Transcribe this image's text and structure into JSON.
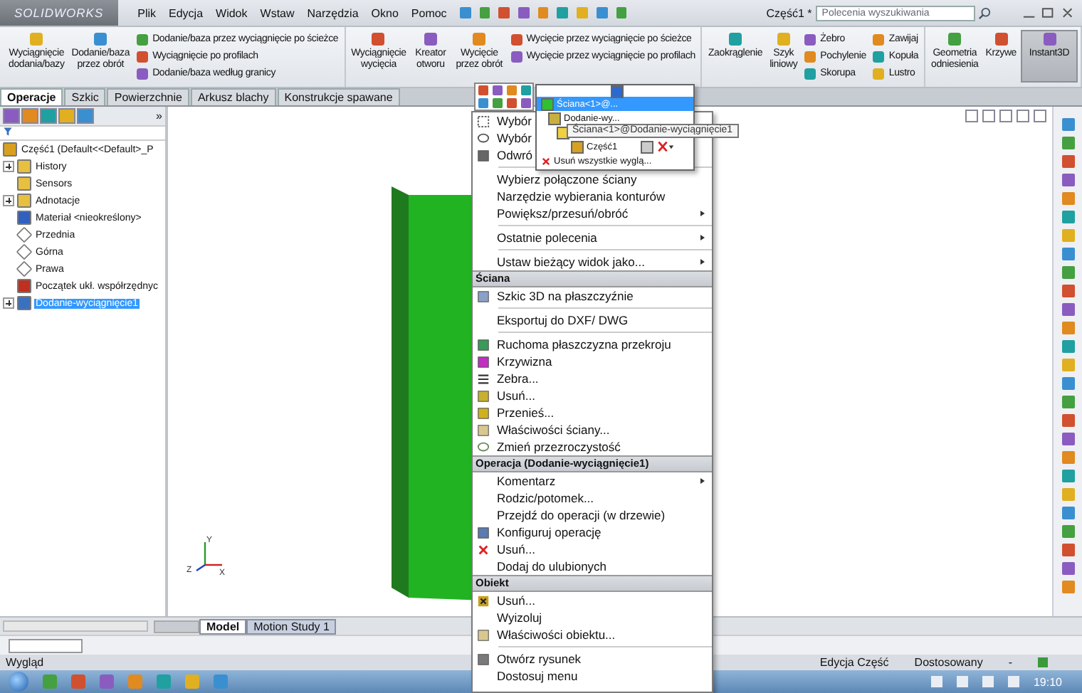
{
  "titlebar": {
    "logo": "SOLIDWORKS",
    "menu": [
      "Plik",
      "Edycja",
      "Widok",
      "Wstaw",
      "Narzędzia",
      "Okno",
      "Pomoc"
    ],
    "title": "Część1 *",
    "search": {
      "placeholder": "Polecenia wyszukiwania"
    }
  },
  "ribbon": {
    "groups": [
      {
        "large": [
          {
            "label": "Wyciągnięcie dodania/bazy",
            "selected": false
          },
          {
            "label": "Dodanie/baza przez obrót",
            "selected": false
          }
        ],
        "columns": [
          [
            "Dodanie/baza przez wyciągnięcie po ścieżce",
            "Wyciągnięcie po profilach",
            "Dodanie/baza według granicy"
          ]
        ]
      },
      {
        "large": [
          {
            "label": "Wyciągnięcie wycięcia",
            "selected": false
          },
          {
            "label": "Kreator otworu",
            "selected": false
          },
          {
            "label": "Wycięcie przez obrót",
            "selected": false
          }
        ],
        "columns": [
          [
            "Wycięcie przez wyciągnięcie po ścieżce",
            "Wycięcie przez wyciągnięcie po profilach"
          ]
        ]
      },
      {
        "large": [
          {
            "label": "Zaokrąglenie",
            "selected": false
          },
          {
            "label": "Szyk liniowy",
            "selected": false
          }
        ],
        "columns": [
          [
            "Żebro",
            "Pochylenie",
            "Skorupa"
          ],
          [
            "Zawijaj",
            "Kopuła",
            "Lustro"
          ]
        ]
      },
      {
        "large": [
          {
            "label": "Geometria odniesienia",
            "selected": false
          },
          {
            "label": "Krzywe",
            "selected": false
          },
          {
            "label": "Instant3D",
            "selected": true
          }
        ]
      }
    ]
  },
  "tabs": [
    {
      "label": "Operacje",
      "selected": true
    },
    {
      "label": "Szkic",
      "selected": false
    },
    {
      "label": "Powierzchnie",
      "selected": false
    },
    {
      "label": "Arkusz blachy",
      "selected": false
    },
    {
      "label": "Konstrukcje spawane",
      "selected": false
    }
  ],
  "panel": {
    "more": "»",
    "tree": {
      "label": "Część1  (Default<<Default>_P",
      "kind": "part",
      "children": [
        {
          "label": "History",
          "kind": "folder",
          "expanded": false,
          "selected": false
        },
        {
          "label": "Sensors",
          "kind": "folder",
          "selected": false
        },
        {
          "label": "Adnotacje",
          "kind": "folder",
          "expanded": false,
          "selected": false
        },
        {
          "label": "Materiał <nieokreślony>",
          "kind": "material",
          "selected": false
        },
        {
          "label": "Przednia",
          "kind": "plane",
          "selected": false
        },
        {
          "label": "Górna",
          "kind": "plane",
          "selected": false
        },
        {
          "label": "Prawa",
          "kind": "plane",
          "selected": false
        },
        {
          "label": "Początek ukł. współrzędnyc",
          "kind": "origin",
          "selected": false
        },
        {
          "label": "Dodanie-wyciągnięcie1",
          "kind": "feature",
          "expanded": false,
          "selected": true
        }
      ]
    }
  },
  "triad": [
    "Y",
    "Z",
    "X"
  ],
  "bottom_tabs": [
    {
      "label": "Model",
      "selected": true
    },
    {
      "label": "Motion Study 1",
      "selected": false
    }
  ],
  "status_bar": {
    "left": "Wygląd",
    "right": [
      "Edycja Część",
      "Dostosowany",
      "-"
    ]
  },
  "taskbar": {
    "clock": "19:10"
  },
  "context_menu": {
    "sections": [
      {
        "blocks": [
          [
            {
              "label": "Wybór",
              "kind": "select",
              "submenu": false
            },
            {
              "label": "Wybór",
              "kind": "lasso",
              "submenu": false
            },
            {
              "label": "Odwró",
              "kind": "invert",
              "submenu": false
            }
          ],
          [
            {
              "label": "Wybierz połączone ściany",
              "kind": "plain",
              "submenu": false
            },
            {
              "label": "Narzędzie wybierania konturów",
              "kind": "plain",
              "submenu": false
            },
            {
              "label": "Powiększ/przesuń/obróć",
              "kind": "plain",
              "submenu": true
            }
          ],
          [
            {
              "label": "Ostatnie polecenia",
              "kind": "plain",
              "submenu": true
            }
          ],
          [
            {
              "label": "Ustaw bieżący widok jako...",
              "kind": "plain",
              "submenu": true
            }
          ]
        ]
      },
      {
        "header": "Ściana",
        "blocks": [
          [
            {
              "label": "Szkic 3D na płaszczyźnie",
              "kind": "sketch",
              "submenu": false
            }
          ],
          [
            {
              "label": "Eksportuj do DXF/ DWG",
              "kind": "plain",
              "submenu": false
            }
          ],
          [
            {
              "label": "Ruchoma płaszczyzna przekroju",
              "kind": "section",
              "submenu": false
            },
            {
              "label": "Krzywizna",
              "kind": "curvature",
              "submenu": false
            },
            {
              "label": "Zebra...",
              "kind": "zebra",
              "submenu": false
            },
            {
              "label": "Usuń...",
              "kind": "face",
              "submenu": false
            },
            {
              "label": "Przenieś...",
              "kind": "move",
              "submenu": false
            },
            {
              "label": "Właściwości ściany...",
              "kind": "props",
              "submenu": false
            },
            {
              "label": "Zmień przezroczystość",
              "kind": "transparency",
              "submenu": false
            }
          ]
        ]
      },
      {
        "header": "Operacja (Dodanie-wyciągnięcie1)",
        "blocks": [
          [
            {
              "label": "Komentarz",
              "kind": "plain",
              "submenu": true
            },
            {
              "label": "Rodzic/potomek...",
              "kind": "plain",
              "submenu": false
            },
            {
              "label": "Przejdź do operacji (w drzewie)",
              "kind": "plain",
              "submenu": false
            },
            {
              "label": "Konfiguruj operację",
              "kind": "config",
              "submenu": false
            },
            {
              "label": "Usuń...",
              "kind": "delete",
              "submenu": false
            },
            {
              "label": "Dodaj do ulubionych",
              "kind": "plain",
              "submenu": false
            }
          ]
        ]
      },
      {
        "header": "Obiekt",
        "blocks": [
          [
            {
              "label": "Usuń...",
              "kind": "delete-box",
              "submenu": false
            },
            {
              "label": "Wyizoluj",
              "kind": "plain",
              "submenu": false
            },
            {
              "label": "Właściwości obiektu...",
              "kind": "props",
              "submenu": false
            }
          ],
          [
            {
              "label": "Otwórz rysunek",
              "kind": "drawing",
              "submenu": false
            },
            {
              "label": "Dostosuj menu",
              "kind": "plain",
              "submenu": false
            }
          ]
        ]
      }
    ]
  },
  "appearance_menu": {
    "items": [
      {
        "kind": "icon-row",
        "selected": false
      },
      {
        "label": "Ściana<1>@...",
        "kind": "face",
        "selected": true
      },
      {
        "label": "Dodanie-wy...",
        "kind": "feature",
        "selected": false
      },
      {
        "kind": "folder",
        "selected": false
      },
      {
        "label": "Część1",
        "kind": "part",
        "selected": false
      },
      {
        "label": "Usuń wszystkie wyglą...",
        "kind": "remove",
        "selected": false
      }
    ]
  },
  "tooltip": "Ściana<1>@Dodanie-wyciągnięcie1"
}
